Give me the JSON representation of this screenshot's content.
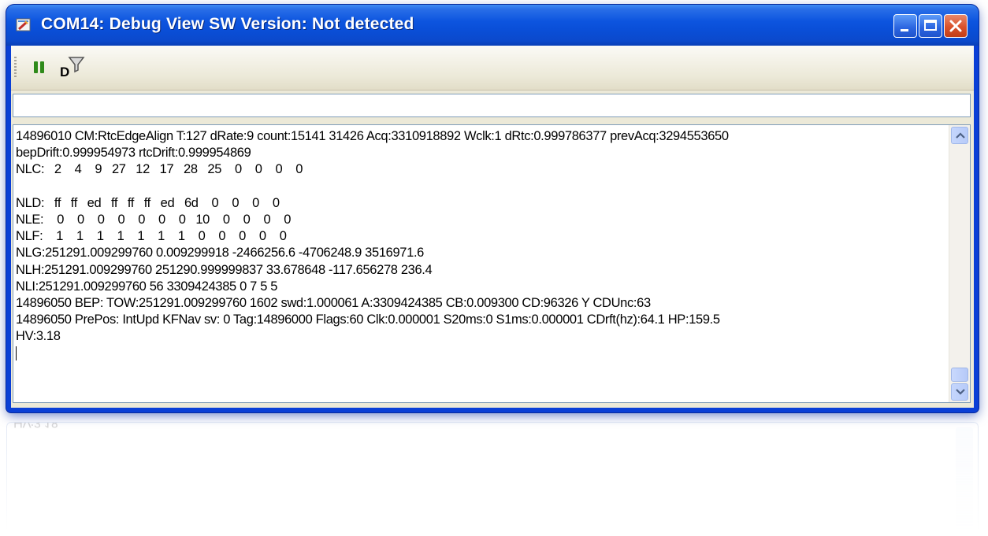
{
  "window": {
    "title": "COM14: Debug View SW Version: Not detected"
  },
  "toolbar": {
    "pause_icon": "pause-icon",
    "filter_icon": "filter-debug-icon",
    "filter_icon_letter": "D"
  },
  "command_input": {
    "value": ""
  },
  "log": {
    "lines": [
      "14896010 CM:RtcEdgeAlign T:127 dRate:9 count:15141 31426 Acq:3310918892 Wclk:1 dRtc:0.999786377 prevAcq:3294553650",
      "bepDrift:0.999954973 rtcDrift:0.999954869",
      "NLC:   2    4    9   27   12   17   28   25    0    0    0    0",
      "",
      "NLD:   ff   ff   ed   ff   ff   ff   ed   6d    0    0    0    0",
      "NLE:    0    0    0    0    0    0    0   10    0    0    0    0",
      "NLF:    1    1    1    1    1    1    1    0    0    0    0    0",
      "NLG:251291.009299760 0.009299918 -2466256.6 -4706248.9 3516971.6",
      "NLH:251291.009299760 251290.999999837 33.678648 -117.656278 236.4",
      "NLI:251291.009299760 56 3309424385 0 7 5 5",
      "14896050 BEP: TOW:251291.009299760 1602 swd:1.000061 A:3309424385 CB:0.009300 CD:96326 Y CDUnc:63",
      "14896050 PrePos: IntUpd KFNav sv: 0 Tag:14896000 Flags:60 Clk:0.000001 S20ms:0 S1ms:0.000001 CDrft(hz):64.1 HP:159.5",
      "HV:3.18"
    ]
  },
  "colors": {
    "titlebar": "#0a4fd8",
    "close_button": "#d9512b",
    "client_bg": "#ece9d8",
    "pause_green": "#2f8a1a"
  }
}
